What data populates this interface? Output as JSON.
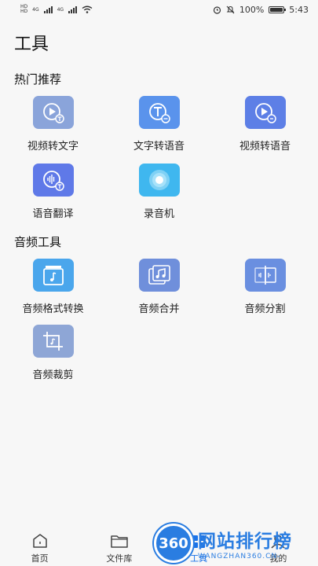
{
  "status_bar": {
    "left_tag_top": "HD",
    "left_tag_bottom": "HD",
    "net1": "4G",
    "net2": "4G",
    "battery_pct": "100%",
    "time": "5:43"
  },
  "page": {
    "title": "工具"
  },
  "sections": [
    {
      "title": "热门推荐",
      "items": [
        {
          "label": "视频转文字",
          "icon": "video-to-text-icon",
          "color": "#8aa4da"
        },
        {
          "label": "文字转语音",
          "icon": "text-to-speech-icon",
          "color": "#5a93ec"
        },
        {
          "label": "视频转语音",
          "icon": "video-to-audio-icon",
          "color": "#5d7fe6"
        },
        {
          "label": "语音翻译",
          "icon": "voice-translate-icon",
          "color": "#5f79e8"
        },
        {
          "label": "录音机",
          "icon": "recorder-icon",
          "color": "#3fb7ef"
        }
      ]
    },
    {
      "title": "音频工具",
      "items": [
        {
          "label": "音频格式转换",
          "icon": "audio-format-convert-icon",
          "color": "#4aa6ec"
        },
        {
          "label": "音频合并",
          "icon": "audio-merge-icon",
          "color": "#6f8fdb"
        },
        {
          "label": "音频分割",
          "icon": "audio-split-icon",
          "color": "#6a8fe0"
        },
        {
          "label": "音频裁剪",
          "icon": "audio-crop-icon",
          "color": "#8ea6d6"
        }
      ]
    }
  ],
  "tabbar": [
    {
      "label": "首页",
      "icon": "home-icon"
    },
    {
      "label": "文件库",
      "icon": "folder-icon"
    },
    {
      "label": "工具",
      "icon": "tools-icon",
      "active": true
    },
    {
      "label": "我的",
      "icon": "profile-icon"
    }
  ],
  "watermark": {
    "badge": "360",
    "main": "网站排行榜",
    "sub": "WANGZHAN360.CN-"
  }
}
